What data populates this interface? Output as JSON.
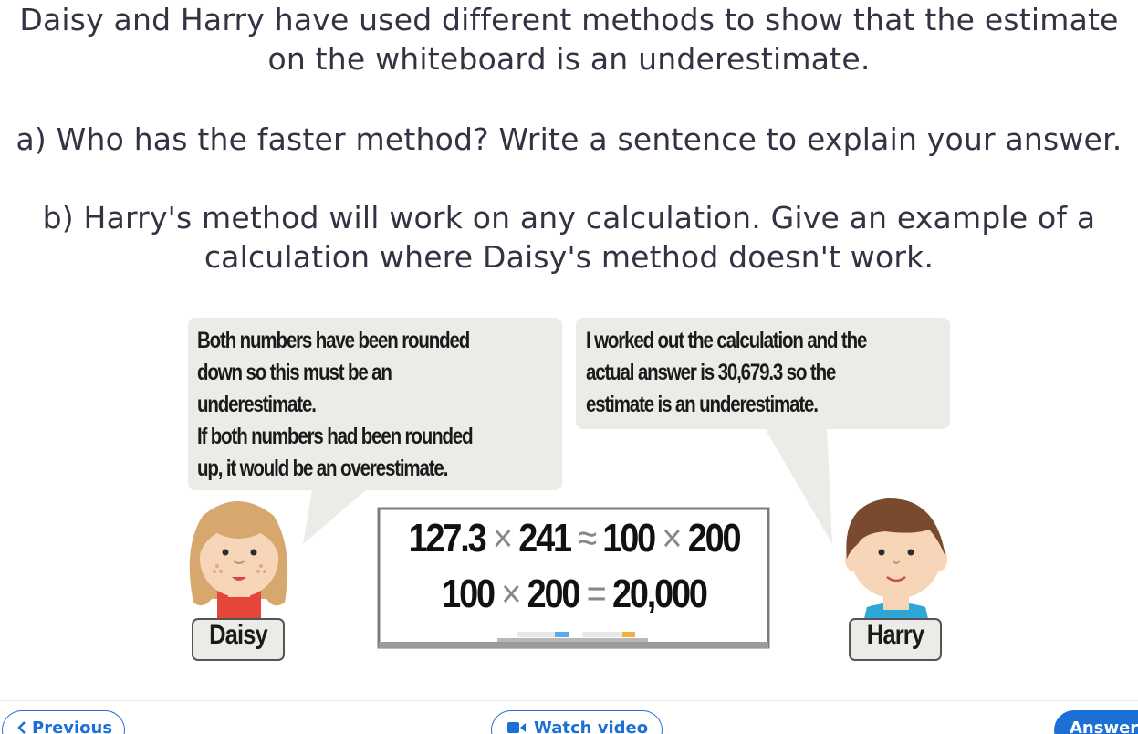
{
  "question": {
    "intro": "Daisy and Harry have used different methods to show that the estimate on the whiteboard is an underestimate.",
    "part_a": "a) Who has the faster method? Write a sentence to explain your answer.",
    "part_b": "b) Harry's method will work on any calculation. Give an example of a calculation where Daisy's method doesn't work."
  },
  "illustration": {
    "daisy_speech": [
      "Both numbers have been rounded",
      "down so this must be an",
      "underestimate.",
      "If both numbers had been rounded",
      "up, it would be an overestimate."
    ],
    "harry_speech": [
      "I worked out the calculation and the",
      "actual answer is 30,679.3 so the",
      "estimate is an underestimate."
    ],
    "whiteboard": {
      "line1": {
        "a": "127.3",
        "op1": "×",
        "b": "241",
        "approx": "≈",
        "c": "100",
        "op2": "×",
        "d": "200"
      },
      "line2": {
        "a": "100",
        "op1": "×",
        "b": "200",
        "eq": "=",
        "c": "20,000"
      }
    },
    "daisy_name": "Daisy",
    "harry_name": "Harry"
  },
  "nav": {
    "previous_label": "Previous",
    "previous_icon": "chevron-left-icon",
    "watch_label": "Watch video",
    "watch_icon": "video-camera-icon",
    "answer_label": "Answer",
    "accent_color": "#1c6fd4"
  }
}
